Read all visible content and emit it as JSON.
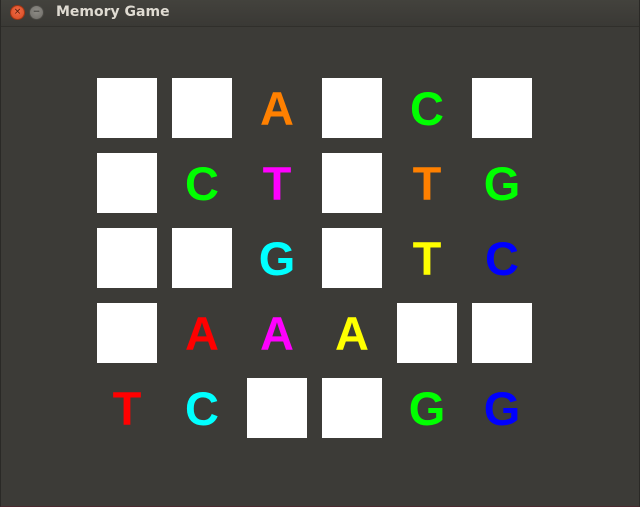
{
  "window": {
    "title": "Memory Game",
    "close_icon": "×",
    "minimize_icon": "−"
  },
  "board": {
    "rows": 5,
    "cols": 6,
    "tiles": [
      [
        {
          "state": "hidden"
        },
        {
          "state": "hidden"
        },
        {
          "state": "revealed",
          "letter": "A",
          "color": "#ff8000"
        },
        {
          "state": "hidden"
        },
        {
          "state": "revealed",
          "letter": "C",
          "color": "#00ff00"
        },
        {
          "state": "hidden"
        }
      ],
      [
        {
          "state": "hidden"
        },
        {
          "state": "revealed",
          "letter": "C",
          "color": "#00ff00"
        },
        {
          "state": "revealed",
          "letter": "T",
          "color": "#ff00ff"
        },
        {
          "state": "hidden"
        },
        {
          "state": "revealed",
          "letter": "T",
          "color": "#ff8000"
        },
        {
          "state": "revealed",
          "letter": "G",
          "color": "#00ff00"
        }
      ],
      [
        {
          "state": "hidden"
        },
        {
          "state": "hidden"
        },
        {
          "state": "revealed",
          "letter": "G",
          "color": "#00ffff"
        },
        {
          "state": "hidden"
        },
        {
          "state": "revealed",
          "letter": "T",
          "color": "#ffff00"
        },
        {
          "state": "revealed",
          "letter": "C",
          "color": "#0000ff"
        }
      ],
      [
        {
          "state": "hidden"
        },
        {
          "state": "revealed",
          "letter": "A",
          "color": "#ff0000"
        },
        {
          "state": "revealed",
          "letter": "A",
          "color": "#ff00ff"
        },
        {
          "state": "revealed",
          "letter": "A",
          "color": "#ffff00"
        },
        {
          "state": "hidden"
        },
        {
          "state": "hidden"
        }
      ],
      [
        {
          "state": "revealed",
          "letter": "T",
          "color": "#ff0000"
        },
        {
          "state": "revealed",
          "letter": "C",
          "color": "#00ffff"
        },
        {
          "state": "hidden"
        },
        {
          "state": "hidden"
        },
        {
          "state": "revealed",
          "letter": "G",
          "color": "#00ff00"
        },
        {
          "state": "revealed",
          "letter": "G",
          "color": "#0000ff"
        }
      ]
    ]
  },
  "colors": {
    "background": "#3c3b37",
    "hidden_tile": "#ffffff"
  }
}
